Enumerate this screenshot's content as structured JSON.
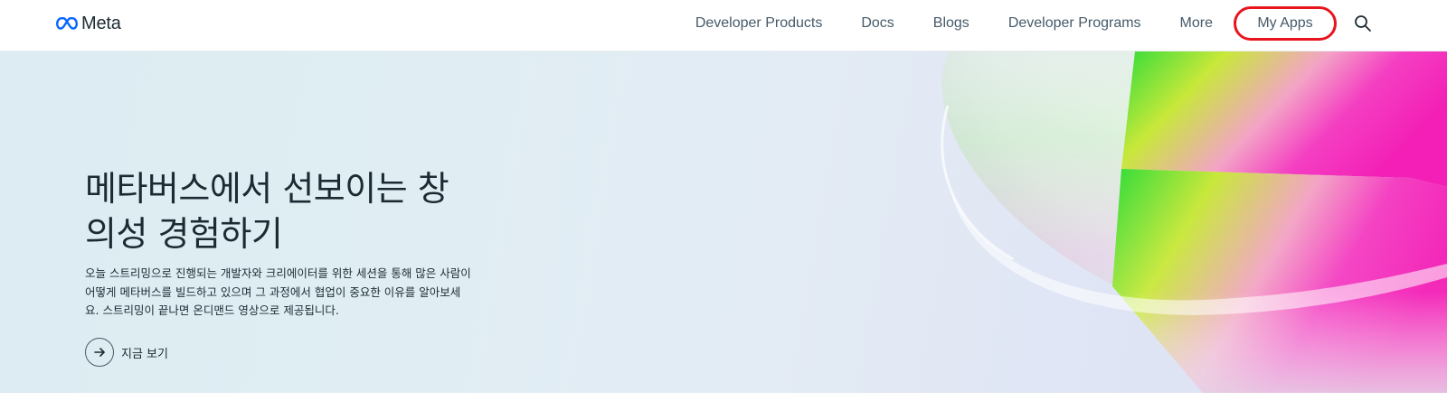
{
  "brand": {
    "name": "Meta",
    "logo_color": "#0866ff"
  },
  "nav": {
    "items": [
      {
        "label": "Developer Products"
      },
      {
        "label": "Docs"
      },
      {
        "label": "Blogs"
      },
      {
        "label": "Developer Programs"
      },
      {
        "label": "More"
      }
    ],
    "my_apps_label": "My Apps",
    "highlight_color": "#e8141d",
    "search_icon": "search-icon"
  },
  "hero": {
    "title": "메타버스에서 선보이는 창의성 경험하기",
    "description": "오늘 스트리밍으로 진행되는 개발자와 크리에이터를 위한 세션을 통해 많은 사람이 어떻게 메타버스를 빌드하고 있으며 그 과정에서 협업이 중요한 이유를 알아보세요. 스트리밍이 끝나면 온디맨드 영상으로 제공됩니다.",
    "cta_label": "지금 보기",
    "cta_icon": "arrow-right-icon"
  }
}
